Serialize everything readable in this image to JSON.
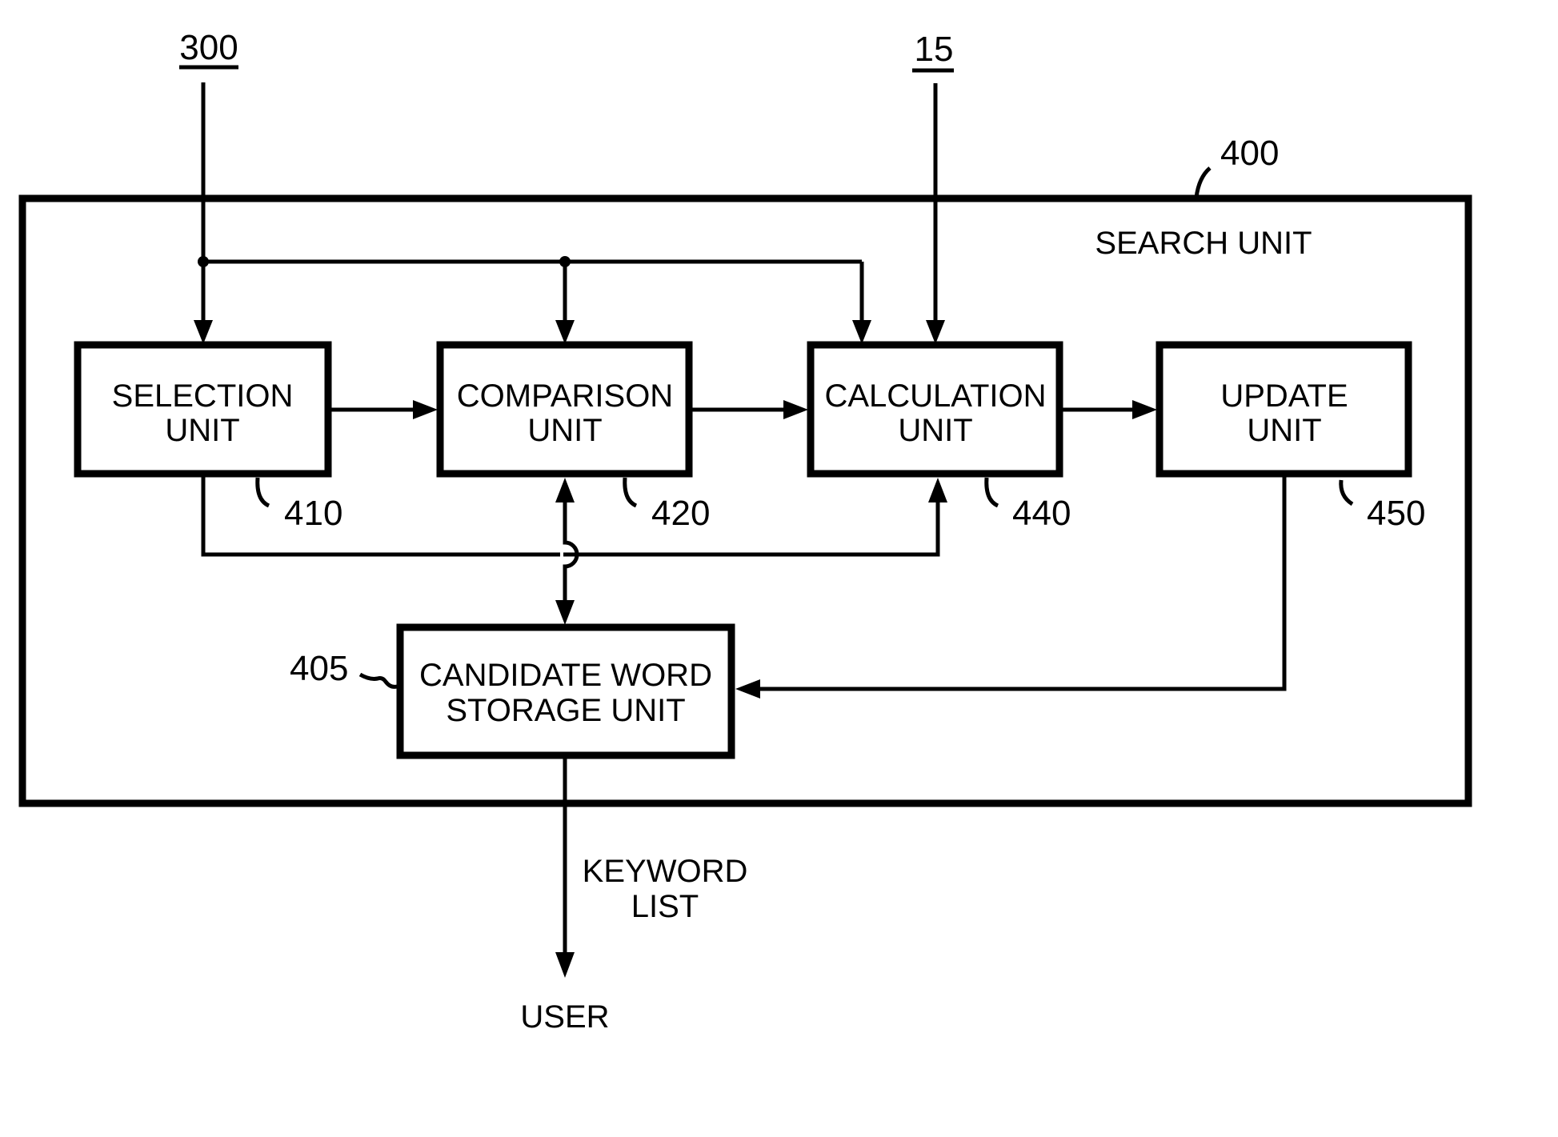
{
  "diagram": {
    "inputs": {
      "source_300": "300",
      "source_15": "15"
    },
    "container": {
      "ref": "400",
      "title": "SEARCH UNIT"
    },
    "blocks": [
      {
        "id": "selection",
        "line1": "SELECTION",
        "line2": "UNIT",
        "ref": "410"
      },
      {
        "id": "comparison",
        "line1": "COMPARISON",
        "line2": "UNIT",
        "ref": "420"
      },
      {
        "id": "calculation",
        "line1": "CALCULATION",
        "line2": "UNIT",
        "ref": "440"
      },
      {
        "id": "update",
        "line1": "UPDATE",
        "line2": "UNIT",
        "ref": "450"
      },
      {
        "id": "candidate",
        "line1": "CANDIDATE WORD",
        "line2": "STORAGE UNIT",
        "ref": "405"
      }
    ],
    "output": {
      "label_line1": "KEYWORD",
      "label_line2": "LIST",
      "destination": "USER"
    },
    "connections": [
      {
        "from": "300",
        "to": "selection"
      },
      {
        "from": "300",
        "to": "comparison"
      },
      {
        "from": "300",
        "to": "calculation"
      },
      {
        "from": "15",
        "to": "calculation"
      },
      {
        "from": "selection",
        "to": "comparison"
      },
      {
        "from": "comparison",
        "to": "calculation"
      },
      {
        "from": "calculation",
        "to": "update"
      },
      {
        "from": "selection",
        "to": "calculation"
      },
      {
        "from": "comparison",
        "to": "candidate",
        "bidirectional": true
      },
      {
        "from": "update",
        "to": "candidate"
      },
      {
        "from": "candidate",
        "to": "USER"
      }
    ]
  }
}
